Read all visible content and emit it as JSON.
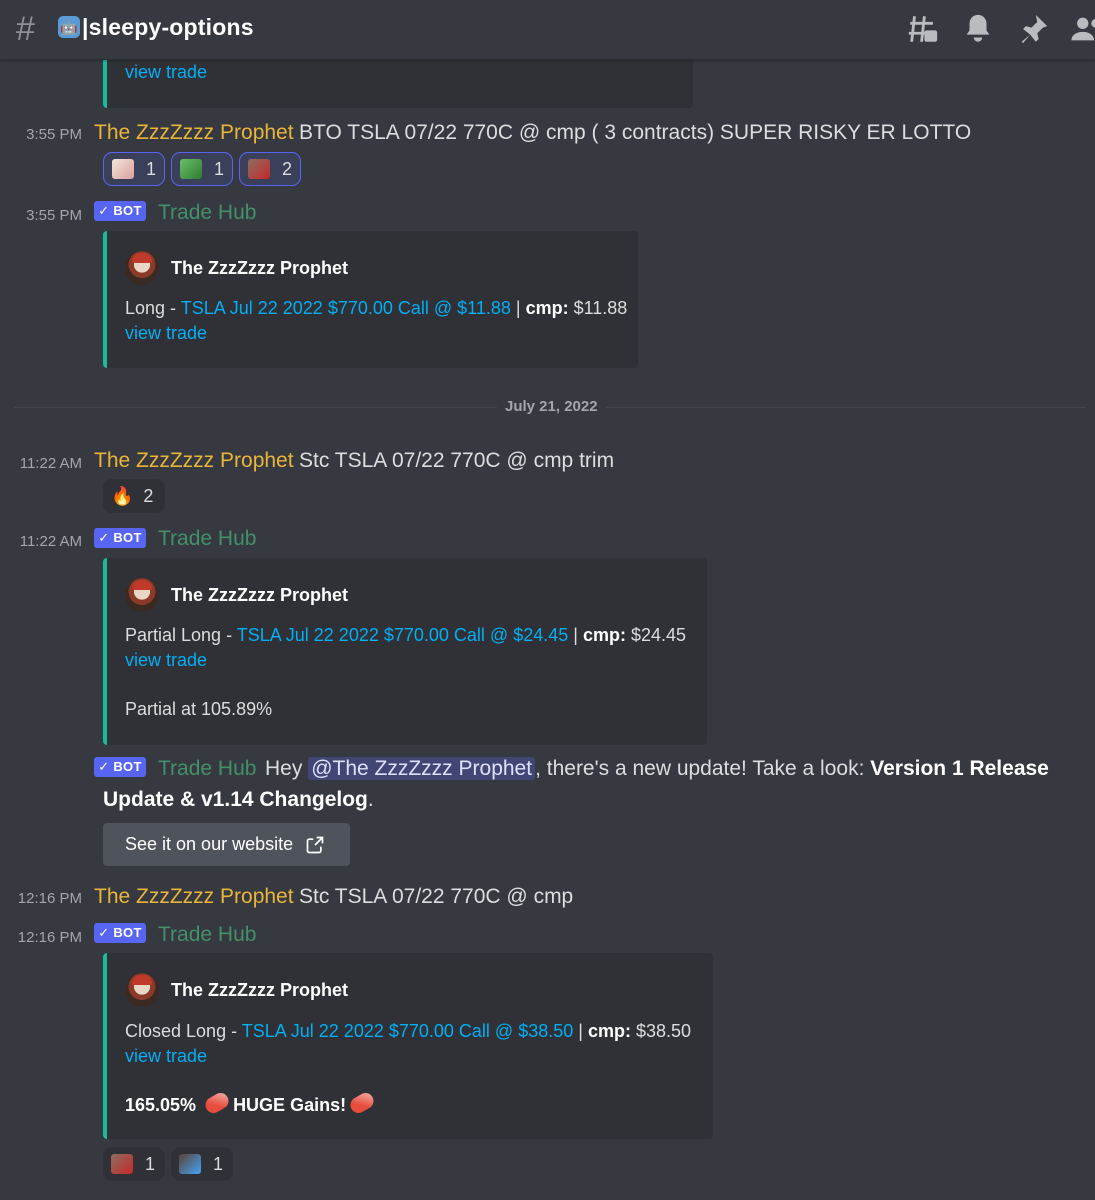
{
  "header": {
    "channel_emoji": "🤖",
    "channel_name": "|sleepy-options",
    "icons": [
      "threads-icon",
      "bell-icon",
      "pin-icon",
      "members-icon"
    ]
  },
  "top_partial": {
    "view_trade": "view trade"
  },
  "msg1": {
    "time": "3:55 PM",
    "author": "The ZzzZzzz Prophet",
    "text": "BTO TSLA 07/22 770C @ cmp ( 3 contracts) SUPER RISKY ER LOTTO",
    "reactions": [
      {
        "emoji": "sticker-emoji",
        "count": "1"
      },
      {
        "emoji": "money-emoji",
        "count": "1"
      },
      {
        "emoji": "face-emoji",
        "count": "2"
      }
    ]
  },
  "msg2": {
    "time": "3:55 PM",
    "badge": "✓ BOT",
    "author": "Trade Hub",
    "embed": {
      "author": "The ZzzZzzz Prophet",
      "prefix": "Long - ",
      "link": "TSLA Jul 22 2022 $770.00 Call @ $11.88",
      "sep": " | ",
      "cmp_label": "cmp:",
      "cmp_value": " $11.88",
      "view_trade": "view trade"
    }
  },
  "date_divider": "July 21, 2022",
  "msg3": {
    "time": "11:22 AM",
    "author": "The ZzzZzzz Prophet",
    "text": "Stc TSLA 07/22 770C @ cmp trim",
    "reaction": {
      "emoji": "🔥",
      "count": "2"
    }
  },
  "msg4": {
    "time": "11:22 AM",
    "badge": "✓ BOT",
    "author": "Trade Hub",
    "embed": {
      "author": "The ZzzZzzz Prophet",
      "prefix": "Partial Long - ",
      "link": "TSLA Jul 22 2022 $770.00 Call @ $24.45",
      "sep": " | ",
      "cmp_label": "cmp:",
      "cmp_value": " $24.45",
      "view_trade": "view trade",
      "footer": "Partial at 105.89%"
    }
  },
  "msg5": {
    "badge": "✓ BOT",
    "author": "Trade Hub",
    "text_before": "Hey ",
    "mention": "@The ZzzZzzz Prophet",
    "text_after": ", there's a new update! Take a look: ",
    "bold1": "Version 1 Release",
    "bold2": "Update & v1.14 Changelog",
    "end": ".",
    "button": "See it on our website"
  },
  "msg6": {
    "time": "12:16 PM",
    "author": "The ZzzZzzz Prophet",
    "text": "Stc TSLA 07/22 770C @ cmp"
  },
  "msg7": {
    "time": "12:16 PM",
    "badge": "✓ BOT",
    "author": "Trade Hub",
    "embed": {
      "author": "The ZzzZzzz Prophet",
      "prefix": "Closed Long - ",
      "link": "TSLA Jul 22 2022 $770.00 Call @ $38.50",
      "sep": " | ",
      "cmp_label": "cmp:",
      "cmp_value": " $38.50",
      "view_trade": "view trade",
      "gains_pct": "165.05% ",
      "gains_text": "HUGE Gains!"
    },
    "reactions": [
      {
        "emoji": "face-emoji",
        "count": "1"
      },
      {
        "emoji": "person-emoji",
        "count": "1"
      }
    ]
  },
  "colors": {
    "background": "#36393f",
    "embed_bg": "#2f3136",
    "embed_border": "#1abc9c",
    "link": "#00aff4",
    "author_gold": "#e9b53b",
    "bot_name": "#43906a",
    "bot_badge": "#5865f2"
  }
}
